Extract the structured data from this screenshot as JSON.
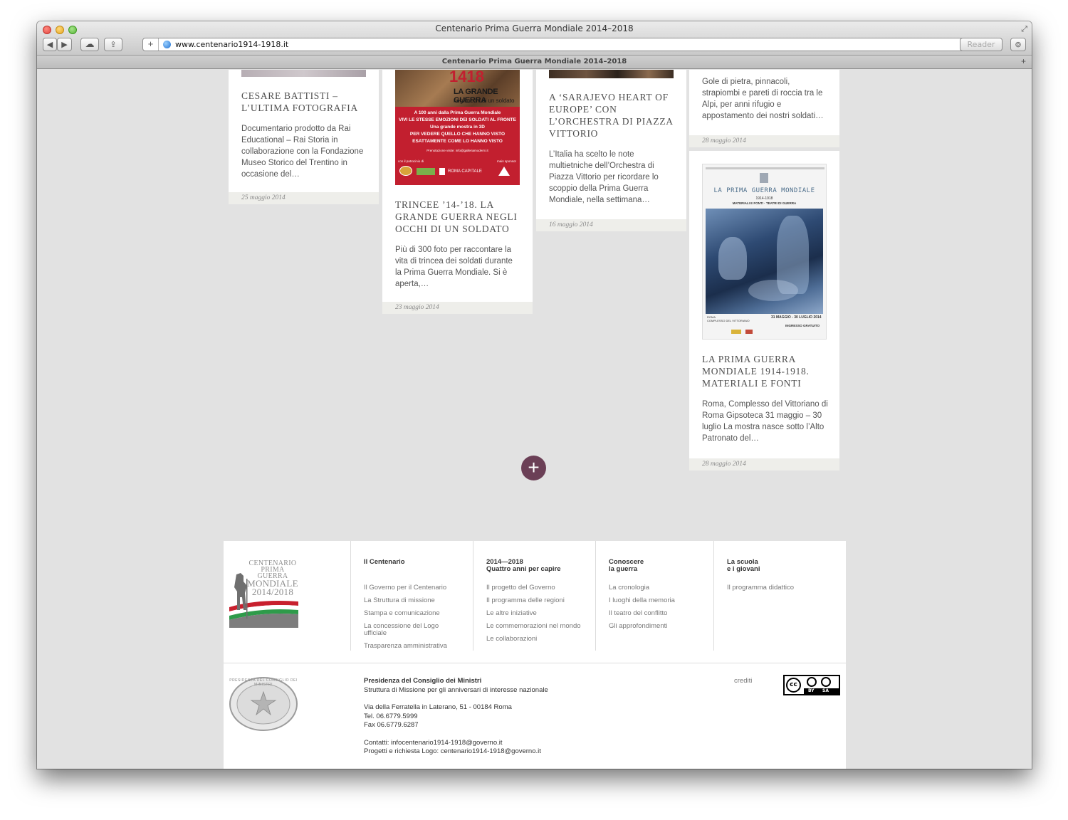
{
  "window": {
    "title": "Centenario Prima Guerra Mondiale 2014–2018"
  },
  "toolbar": {
    "back": "◀",
    "forward": "▶",
    "icloud": "☁",
    "share": "⇪",
    "new_tab": "+",
    "url": "www.centenario1914-1918.it",
    "reader": "Reader",
    "reload": "↻",
    "downloads": "⊚",
    "fullscreen": "⤢"
  },
  "tab": {
    "title": "Centenario Prima Guerra Mondiale 2014–2018",
    "add": "+"
  },
  "cards": [
    {
      "title": "Cesare Battisti – l’ultima fotografia",
      "excerpt": "Documentario prodotto da Rai Educational – Rai Storia in collaborazione con la Fondazione Museo Storico del Trentino in occasione del…",
      "date": "25 maggio 2014"
    },
    {
      "title": "Trincee ’14-’18. La Grande Guerra negli occhi di un soldato",
      "excerpt": "Più di 300 foto per raccontare la vita di trincea dei soldati durante la Prima Guerra Mondiale. Si è aperta,…",
      "date": "23 maggio 2014",
      "poster": {
        "big": "1418",
        "headline": "LA GRANDE GUERRA",
        "sub": "negli occhi di un soldato",
        "lines": [
          "A 100 anni dalla Prima Guerra Mondiale",
          "VIVI LE STESSE EMOZIONI DEI SOLDATI AL FRONTE",
          "Una grande mostra in 3D",
          "PER VEDERE QUELLO CHE HANNO VISTO",
          "ESATTAMENTE COME LO HANNO VISTO"
        ],
        "info": "Prenotazione visite: info@galleriamoderni.it",
        "patronage": "con il patrocinio di",
        "sponsor_label": "main sponsor",
        "roma": "ROMA CAPITALE"
      }
    },
    {
      "title": "A ‘Sarajevo Heart of Europe’ con l’Orchestra di Piazza Vittorio",
      "excerpt": "L’Italia ha scelto le note multietniche dell’Orchestra di Piazza Vittorio per ricordare lo scoppio della Prima Guerra Mondiale, nella settimana…",
      "date": "16 maggio 2014"
    },
    {
      "excerpt": "Gole di pietra, pinnacoli, strapiombi e pareti di roccia tra le Alpi, per anni rifugio e appostamento dei nostri soldati…",
      "date": "28 maggio 2014"
    },
    {
      "title": "La Prima Guerra Mondiale 1914-1918. Materiali e fonti",
      "excerpt": "Roma, Complesso del Vittoriano di Roma Gipsoteca 31 maggio – 30 luglio  La mostra nasce sotto l’Alto Patronato del…",
      "date": "28 maggio 2014",
      "poster": {
        "heading": "LA PRIMA GUERRA MONDIALE",
        "years": "1914-1918",
        "subtitle": "MATERIALI E FONTI · TEATRI DI GUERRA",
        "place": "ROMA\nCOMPLESSO DEL VITTORIANO",
        "dates": "31 MAGGIO - 30 LUGLIO 2014",
        "entry": "INGRESSO GRATUITO"
      }
    }
  ],
  "more_button": "+",
  "footer": {
    "logo": {
      "line1": "CENTENARIO",
      "line2": "PRIMA GUERRA",
      "line3": "MONDIALE",
      "line4": "2014/2018"
    },
    "columns": [
      {
        "title": "Il Centenario",
        "links": [
          "Il Governo per il Centenario",
          "La Struttura di missione",
          "Stampa e comunicazione",
          "La concessione del Logo\nufficiale",
          "Trasparenza amministrativa"
        ]
      },
      {
        "title": "2014—2018\nQuattro anni per capire",
        "links": [
          "Il progetto del Governo",
          "Il programma delle regioni",
          "Le altre iniziative",
          "Le commemorazioni nel mondo",
          "Le collaborazioni"
        ]
      },
      {
        "title": "Conoscere\nla guerra",
        "links": [
          "La cronologia",
          "I luoghi della memoria",
          "Il teatro del conflitto",
          "Gli approfondimenti"
        ]
      },
      {
        "title": "La scuola\ne i giovani",
        "links": [
          "Il programma didattico"
        ]
      }
    ],
    "seal_text": "PRESIDENZA DEL CONSIGLIO DEI MINISTRI",
    "org_name": "Presidenza del Consiglio dei Ministri",
    "org_sub": "Struttura di Missione per gli anniversari di interesse nazionale",
    "address": "Via della Ferratella in Laterano, 51 - 00184 Roma",
    "tel": "Tel. 06.6779.5999",
    "fax": "Fax 06.6779.6287",
    "contacts": "Contatti: infocentenario1914-1918@governo.it",
    "projects": "Progetti e richiesta Logo: centenario1914-1918@governo.it",
    "credits": "crediti",
    "license": {
      "cc": "cc",
      "by": "BY",
      "sa": "SA"
    }
  }
}
